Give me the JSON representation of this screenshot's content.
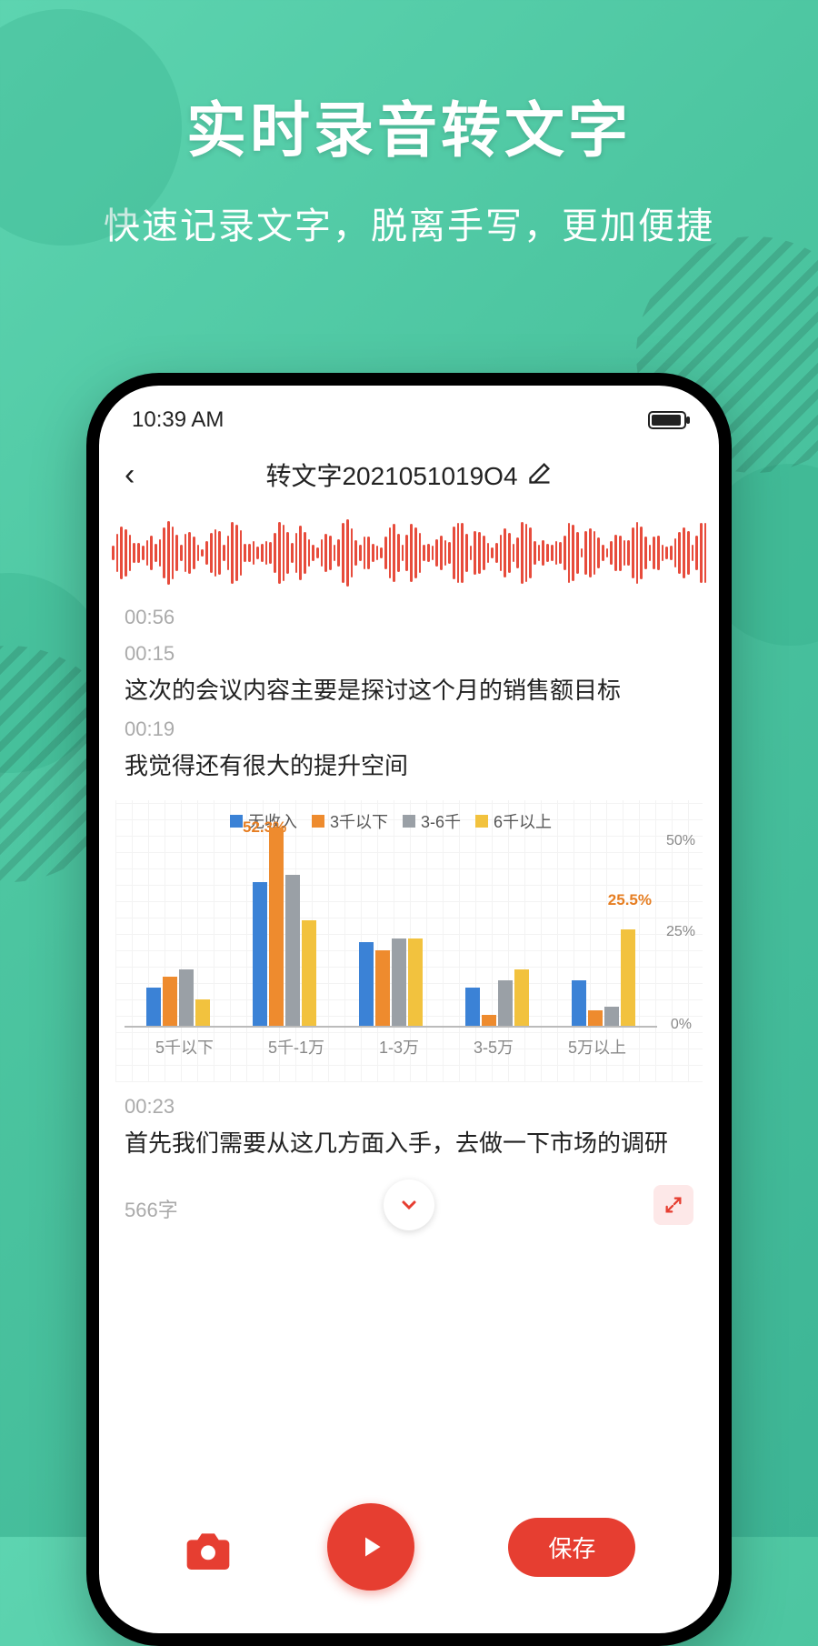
{
  "hero": {
    "title": "实时录音转文字",
    "subtitle": "快速记录文字，脱离手写，更加便捷"
  },
  "status": {
    "time": "10:39 AM"
  },
  "nav": {
    "title": "转文字2021051019O4"
  },
  "audio": {
    "total_time": "00:56"
  },
  "entries": [
    {
      "ts": "00:15",
      "text": "这次的会议内容主要是探讨这个月的销售额目标"
    },
    {
      "ts": "00:19",
      "text": "我觉得还有很大的提升空间"
    },
    {
      "ts": "00:23",
      "text": "首先我们需要从这几方面入手，去做一下市场的调研"
    }
  ],
  "footer": {
    "word_count": "566字",
    "save_label": "保存"
  },
  "colors": {
    "accent": "#e63e31",
    "blue": "#3b82d6",
    "orange": "#ee8b2e",
    "gray": "#9aa0a6",
    "yellow": "#f2c23e"
  },
  "chart_data": {
    "type": "bar",
    "categories": [
      "5千以下",
      "5千-1万",
      "1-3万",
      "3-5万",
      "5万以上"
    ],
    "series": [
      {
        "name": "无收入",
        "color": "#3b82d6",
        "values": [
          10,
          38,
          22,
          10,
          12
        ]
      },
      {
        "name": "3千以下",
        "color": "#ee8b2e",
        "values": [
          13,
          52.3,
          20,
          3,
          4
        ]
      },
      {
        "name": "3-6千",
        "color": "#9aa0a6",
        "values": [
          15,
          40,
          23,
          12,
          5
        ]
      },
      {
        "name": "6千以上",
        "color": "#f2c23e",
        "values": [
          7,
          28,
          23,
          15,
          25.5
        ]
      }
    ],
    "ylim": [
      0,
      50
    ],
    "yticks": [
      "0%",
      "25%",
      "50%"
    ],
    "annotations": [
      {
        "text": "52.3%",
        "group": 1
      },
      {
        "text": "25.5%",
        "group": 4
      }
    ]
  }
}
